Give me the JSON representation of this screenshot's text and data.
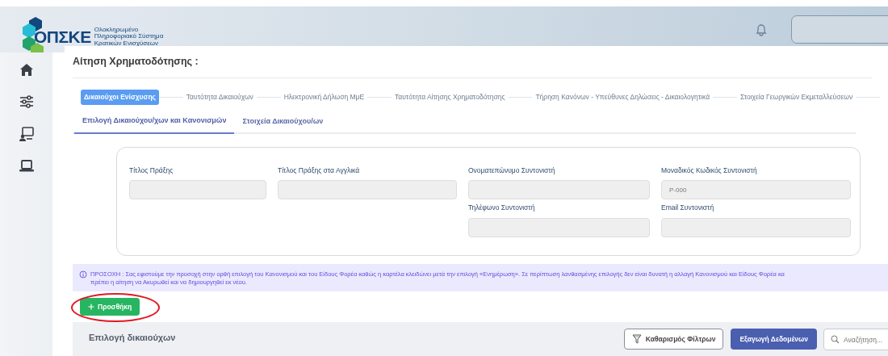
{
  "logo": {
    "name": "ΟΠΣΚΕ",
    "subtitle": [
      "Ολοκληρωμένο",
      "Πληροφοριακό Σύστημα",
      "Κρατικών Ενισχύσεων"
    ]
  },
  "sidebar": {
    "items": [
      {
        "selected": false
      },
      {
        "selected": false
      },
      {
        "selected": false
      },
      {
        "selected": false
      }
    ]
  },
  "page_title": "Αίτηση Χρηματοδότησης :",
  "steps": [
    {
      "label": "Δικαιούχοι Ενίσχυσης",
      "selected": true
    },
    {
      "label": "Ταυτότητα Δικαιούχων",
      "selected": false
    },
    {
      "label": "Ηλεκτρονική Δήλωση ΜμΕ",
      "selected": false
    },
    {
      "label": "Ταυτότητα Αίτησης Χρηματοδότησης",
      "selected": false
    },
    {
      "label": "Τήρηση Κανόνων - Υπεύθυνες Δηλώσεις - Δικαιολογητικά",
      "selected": false
    },
    {
      "label": "Στοιχεία Γεωργικών Εκμεταλλεύσεων",
      "selected": false
    }
  ],
  "tabs": [
    {
      "label": "Επιλογή Δικαιούχου/χων και Κανονισμών",
      "selected": true
    },
    {
      "label": "Στοιχεία Δικαιούχου/ων",
      "selected": false
    }
  ],
  "fields": [
    {
      "label": "Τίτλος Πράξης"
    },
    {
      "label": "Τίτλος Πράξης στα Αγγλικά"
    },
    {
      "label": "Ονοματεπώνυμο Συντονιστή"
    },
    {
      "label": "Μοναδικός Κωδικός Συντονιστή",
      "value": "P-000"
    },
    {
      "label": "Τηλέφωνο Συντονιστή"
    },
    {
      "label": "Email Συντονιστή"
    }
  ],
  "alert": {
    "lines": [
      "ΠΡΟΣΟΧΗ : Σας εφιστούμε την προσοχή στην ορθή επιλογή του Κανονισμού και του Είδους Φορέα καθώς η καρτέλα κλειδώνει μετά την επιλογή «Ενημέρωση». Σε περίπτωση λανθασμένης επιλογής δεν είναι δυνατή η αλλαγή Κανονισμού και Είδους Φορέα κα",
      "πρέπει η αίτηση να Ακυρωθεί και να δημιουργηθεί εκ νέου."
    ]
  },
  "add_button": {
    "label": "Προσθήκη",
    "highlighted": true
  },
  "beneficiaries": {
    "title": "Επιλογή δικαιούχων",
    "clear_filters": "Καθαρισμός Φίλτρων",
    "export": "Εξαγωγή Δεδομένων",
    "search": {
      "placeholder": "Αναζήτηση..."
    }
  }
}
